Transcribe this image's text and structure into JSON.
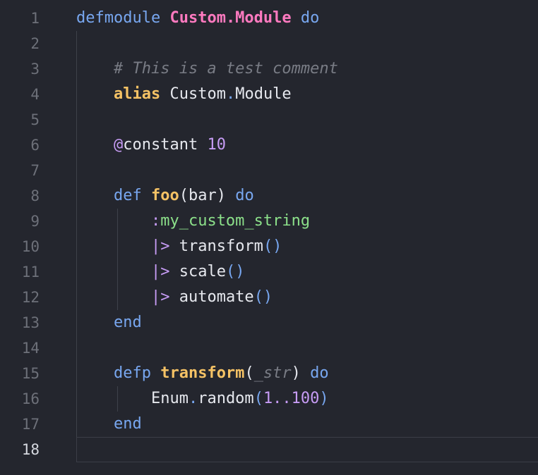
{
  "editor": {
    "active_line": 18,
    "line_numbers": [
      "1",
      "2",
      "3",
      "4",
      "5",
      "6",
      "7",
      "8",
      "9",
      "10",
      "11",
      "12",
      "13",
      "14",
      "15",
      "16",
      "17",
      "18"
    ],
    "code": {
      "l1": {
        "defmodule": "defmodule",
        "module": "Custom.Module",
        "do": "do"
      },
      "l3": {
        "comment": "# This is a test comment"
      },
      "l4": {
        "alias": "alias",
        "mod_a": "Custom",
        "dot": ".",
        "mod_b": "Module"
      },
      "l6": {
        "at": "@",
        "name": "constant",
        "value": "10"
      },
      "l8": {
        "def": "def",
        "fname": "foo",
        "open": "(",
        "arg": "bar",
        "close": ")",
        "do": "do"
      },
      "l9": {
        "colon": ":",
        "atom": "my_custom_string"
      },
      "l10": {
        "pipe": "|>",
        "call": "transform",
        "parens": "()"
      },
      "l11": {
        "pipe": "|>",
        "call": "scale",
        "parens": "()"
      },
      "l12": {
        "pipe": "|>",
        "call": "automate",
        "parens": "()"
      },
      "l13": {
        "end": "end"
      },
      "l15": {
        "defp": "defp",
        "fname": "transform",
        "open": "(",
        "arg": "_str",
        "close": ")",
        "do": "do"
      },
      "l16": {
        "mod": "Enum",
        "dot": ".",
        "call": "random",
        "open": "(",
        "range": "1..100",
        "close": ")"
      },
      "l17": {
        "end": "end"
      }
    }
  },
  "colors": {
    "background": "#24262e",
    "keyword": "#78a7f0",
    "module": "#ff7ac0",
    "function": "#f5c265",
    "comment": "#797c85",
    "number": "#c79cf5",
    "atom": "#8ce08a"
  }
}
